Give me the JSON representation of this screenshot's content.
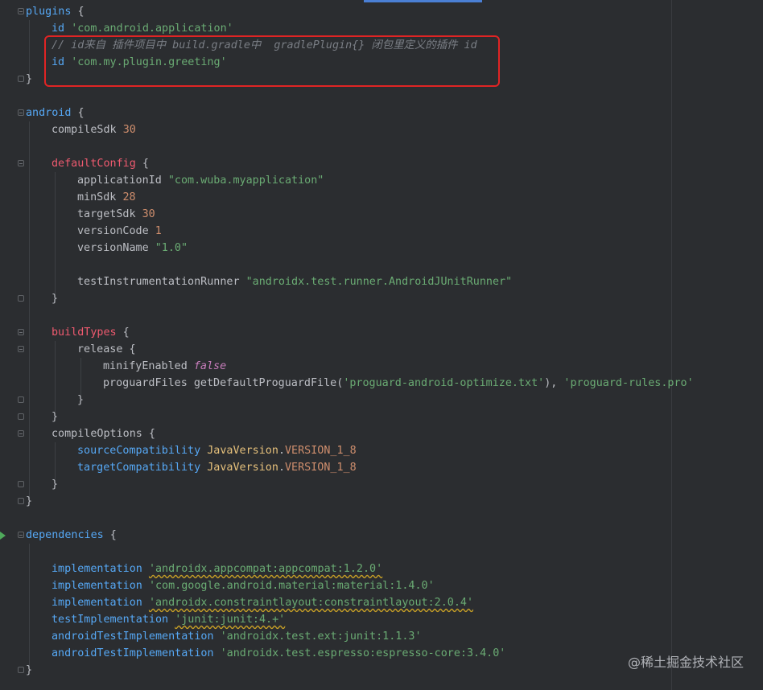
{
  "colors": {
    "background": "#2b2d30",
    "keyword_block": "#56a8f5",
    "string": "#6aab73",
    "number": "#2aacb8",
    "comment": "#7a7e85",
    "config_block": "#ef5a6f",
    "boolean": "#c77dbb",
    "class_name": "#e5c07b",
    "highlight_box": "#e02424"
  },
  "code": {
    "plugins_kw": "plugins",
    "open_brace": " {",
    "close_brace": "}",
    "id_kw": "id",
    "plugin_app": "'com.android.application'",
    "comment_line": "// id来自 插件项目中 build.gradle中  gradlePlugin{} 闭包里定义的插件 id",
    "plugin_greeting": "'com.my.plugin.greeting'",
    "android_kw": "android",
    "compileSdk_kw": "compileSdk",
    "compileSdk_val": "30",
    "defaultConfig_kw": "defaultConfig",
    "applicationId_kw": "applicationId",
    "applicationId_val": "\"com.wuba.myapplication\"",
    "minSdk_kw": "minSdk",
    "minSdk_val": "28",
    "targetSdk_kw": "targetSdk",
    "targetSdk_val": "30",
    "versionCode_kw": "versionCode",
    "versionCode_val": "1",
    "versionName_kw": "versionName",
    "versionName_val": "\"1.0\"",
    "runner_kw": "testInstrumentationRunner",
    "runner_val": "\"androidx.test.runner.AndroidJUnitRunner\"",
    "buildTypes_kw": "buildTypes",
    "release_kw": "release",
    "minify_kw": "minifyEnabled",
    "minify_val": "false",
    "proguard_kw": "proguardFiles",
    "proguard_fn": "getDefaultProguardFile(",
    "proguard_file1": "'proguard-android-optimize.txt'",
    "proguard_mid": "), ",
    "proguard_file2": "'proguard-rules.pro'",
    "compileOptions_kw": "compileOptions",
    "sourceCompat_kw": "sourceCompatibility",
    "targetCompat_kw": "targetCompatibility",
    "java_version_cls": "JavaVersion",
    "java_version_dot": ".",
    "java_version_const": "VERSION_1_8",
    "dependencies_kw": "dependencies",
    "implementation_kw": "implementation",
    "testImplementation_kw": "testImplementation",
    "androidTestImplementation_kw": "androidTestImplementation",
    "dep_appcompat": "'androidx.appcompat:appcompat:1.2.0'",
    "dep_material": "'com.google.android.material:material:1.4.0'",
    "dep_constraint": "'androidx.constraintlayout:constraintlayout:2.0.4'",
    "dep_junit": "'junit:junit:4.+'",
    "dep_ext_junit": "'androidx.test.ext:junit:1.1.3'",
    "dep_espresso": "'androidx.test.espresso:espresso-core:3.4.0'"
  },
  "watermark": "@稀土掘金技术社区"
}
